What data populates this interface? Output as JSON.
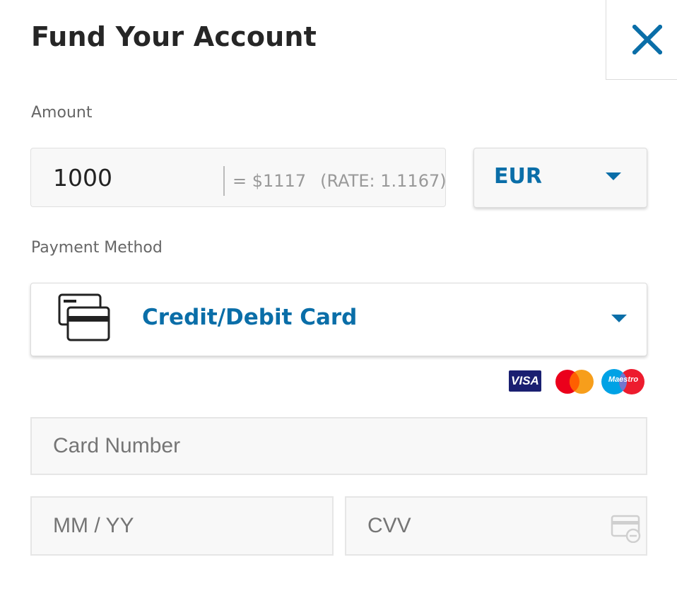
{
  "header": {
    "title": "Fund Your Account",
    "close_icon": "close-icon"
  },
  "amount": {
    "label": "Amount",
    "value": "1000",
    "converted": "= $1117",
    "rate": "(RATE: 1.1167)"
  },
  "currency": {
    "selected": "EUR",
    "dropdown_icon": "chevron-down-icon"
  },
  "payment": {
    "label": "Payment Method",
    "selected": "Credit/Debit Card",
    "method_icon": "credit-cards-icon",
    "dropdown_icon": "chevron-down-icon"
  },
  "card_brands": {
    "visa": "VISA",
    "mastercard_icon": "mastercard-logo",
    "maestro": "Maestro"
  },
  "card_form": {
    "card_number_placeholder": "Card Number",
    "expiry_placeholder": "MM / YY",
    "cvv_placeholder": "CVV",
    "cvv_icon": "cvv-card-icon"
  },
  "colors": {
    "accent": "#0a6ea8",
    "field_bg": "#f8f8f8",
    "border": "#e0e0e0"
  }
}
